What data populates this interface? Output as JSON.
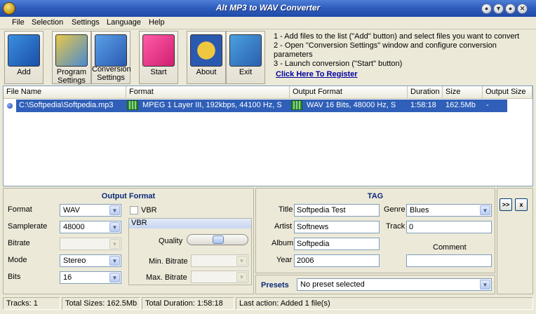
{
  "window": {
    "title": "Alt MP3 to WAV Converter",
    "controls": [
      "●",
      "▼",
      "●",
      "✕"
    ]
  },
  "menu": [
    {
      "label": "File"
    },
    {
      "label": "Selection"
    },
    {
      "label": "Settings"
    },
    {
      "label": "Language"
    },
    {
      "label": "Help"
    }
  ],
  "toolbar": {
    "add": "Add",
    "program_settings": "Program Settings",
    "conversion_settings": "Conversion Settings",
    "start": "Start",
    "about": "About",
    "exit": "Exit"
  },
  "instructions": [
    "1 - Add files to the list (\"Add\" button) and select files you want to convert",
    "2 - Open \"Conversion Settings\" window and configure conversion parameters",
    "3 - Launch conversion (\"Start\" button)"
  ],
  "register_link": "Click Here To Register",
  "file_list": {
    "columns": [
      "File Name",
      "Format",
      "Output Format",
      "Duration",
      "Size",
      "Output Size"
    ],
    "rows": [
      {
        "file_name": "C:\\Softpedia\\Softpedia.mp3",
        "format": "MPEG 1 Layer III, 192kbps, 44100 Hz, S",
        "output_format": "WAV 16 Bits, 48000 Hz, S",
        "duration": "1:58:18",
        "size": "162.5Mb",
        "output_size": "-"
      }
    ]
  },
  "output_format": {
    "title": "Output Format",
    "format_label": "Format",
    "format_value": "WAV",
    "samplerate_label": "Samplerate",
    "samplerate_value": "48000",
    "bitrate_label": "Bitrate",
    "bitrate_value": "",
    "mode_label": "Mode",
    "mode_value": "Stereo",
    "bits_label": "Bits",
    "bits_value": "16",
    "vbr_checkbox_label": "VBR",
    "vbr_group_title": "VBR",
    "quality_label": "Quality",
    "min_bitrate_label": "Min. Bitrate",
    "max_bitrate_label": "Max. Bitrate"
  },
  "tag": {
    "title": "TAG",
    "title_label": "Title",
    "title_value": "Softpedia Test",
    "artist_label": "Artist",
    "artist_value": "Softnews",
    "album_label": "Album",
    "album_value": "Softpedia",
    "year_label": "Year",
    "year_value": "2006",
    "genre_label": "Genre",
    "genre_value": "Blues",
    "track_label": "Track",
    "track_value": "0",
    "comment_label": "Comment",
    "comment_value": ""
  },
  "presets": {
    "label": "Presets",
    "value": "No preset selected"
  },
  "side_buttons": {
    "expand": ">>",
    "close": "x"
  },
  "status": {
    "tracks": "Tracks: 1",
    "total_sizes": "Total Sizes: 162.5Mb",
    "total_duration": "Total Duration: 1:58:18",
    "last_action": "Last action: Added 1 file(s)"
  }
}
